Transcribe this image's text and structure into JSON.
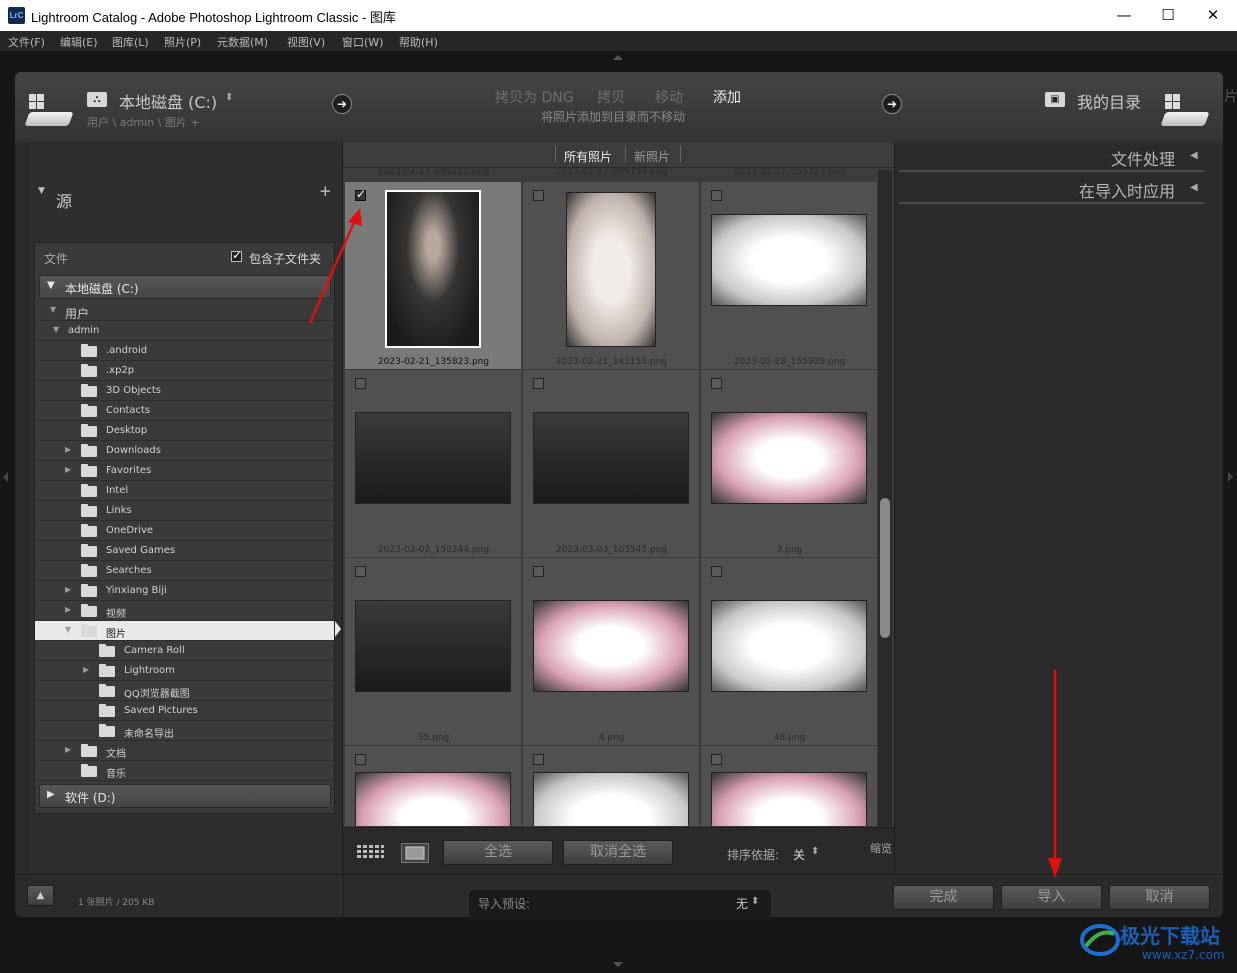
{
  "window": {
    "title": "Lightroom Catalog - Adobe Photoshop Lightroom Classic - 图库",
    "app_icon": "LrC",
    "minimize": "—",
    "maximize": "☐",
    "close": "✕"
  },
  "menu": [
    "文件(F)",
    "编辑(E)",
    "图库(L)",
    "照片(P)",
    "元数据(M)",
    "视图(V)",
    "窗口(W)",
    "帮助(H)"
  ],
  "header": {
    "source_name": "本地磁盘 (C:)",
    "source_path": "用户 \\ admin \\ 图片 +",
    "modes": [
      "拷贝为 DNG",
      "拷贝",
      "移动",
      "添加"
    ],
    "active_mode": "添加",
    "mode_description": "将照片添加到目录而不移动",
    "dest_name": "我的目录",
    "right_edge_text": "片"
  },
  "source_panel": {
    "title": "源",
    "add_icon": "+",
    "files_label": "文件",
    "include_subfolders": "包含子文件夹",
    "include_subfolders_checked": true,
    "drive_c": "本地磁盘 (C:)",
    "drive_d": "软件 (D:)",
    "tree": [
      {
        "label": "用户",
        "expanded": true
      },
      {
        "label": "admin",
        "expanded": true
      },
      {
        "label": ".android"
      },
      {
        "label": ".xp2p"
      },
      {
        "label": "3D Objects"
      },
      {
        "label": "Contacts"
      },
      {
        "label": "Desktop"
      },
      {
        "label": "Downloads",
        "has_children": true
      },
      {
        "label": "Favorites",
        "has_children": true
      },
      {
        "label": "Intel"
      },
      {
        "label": "Links"
      },
      {
        "label": "OneDrive"
      },
      {
        "label": "Saved Games"
      },
      {
        "label": "Searches"
      },
      {
        "label": "Yinxiang Biji",
        "has_children": true
      },
      {
        "label": "视频",
        "has_children": true
      },
      {
        "label": "图片",
        "expanded": true,
        "selected": true
      },
      {
        "label": "Camera Roll"
      },
      {
        "label": "Lightroom",
        "has_children": true
      },
      {
        "label": "QQ浏览器截图"
      },
      {
        "label": "Saved Pictures"
      },
      {
        "label": "未命名导出"
      },
      {
        "label": "文档",
        "has_children": true
      },
      {
        "label": "音乐"
      }
    ]
  },
  "grid": {
    "tabs": [
      "所有照片",
      "新照片"
    ],
    "active_tab": "所有照片",
    "partial_names": [
      "2023-02-17_085155.png",
      "2023-02-17_085754.png",
      "2023-02-17_155727.png"
    ],
    "cells": [
      {
        "name": "2023-02-21_135823.png",
        "checked": true,
        "kind": "face"
      },
      {
        "name": "2023-02-21_141153.png",
        "checked": false,
        "kind": "beige"
      },
      {
        "name": "2023-02-28_155929.png",
        "checked": false,
        "kind": "light"
      },
      {
        "name": "2023-03-02_150244.png",
        "checked": false,
        "kind": "dark"
      },
      {
        "name": "2023-03-03_103545.png",
        "checked": false,
        "kind": "dark"
      },
      {
        "name": "3.png",
        "checked": false,
        "kind": "pink"
      },
      {
        "name": "35.png",
        "checked": false,
        "kind": "dark"
      },
      {
        "name": "4.png",
        "checked": false,
        "kind": "pink"
      },
      {
        "name": "48.png",
        "checked": false,
        "kind": "light"
      },
      {
        "name": "",
        "checked": false,
        "kind": "pink"
      },
      {
        "name": "",
        "checked": false,
        "kind": "light"
      },
      {
        "name": "",
        "checked": false,
        "kind": "pink"
      }
    ],
    "select_all": "全选",
    "deselect_all": "取消全选",
    "sort_label": "排序依据:",
    "sort_value": "关",
    "thumb_label": "缩览"
  },
  "right_panel": {
    "file_handling": "文件处理",
    "apply_during_import": "在导入时应用"
  },
  "bottom": {
    "photo_count": "1 张照片 / 205 KB",
    "preset_label": "导入预设:",
    "preset_value": "无",
    "done": "完成",
    "import": "导入",
    "cancel": "取消"
  },
  "watermark": {
    "text": "极光下载站",
    "url": "www.xz7.com"
  },
  "colors": {
    "accent_red": "#e01010",
    "panel_bg": "#2b2b2b"
  }
}
